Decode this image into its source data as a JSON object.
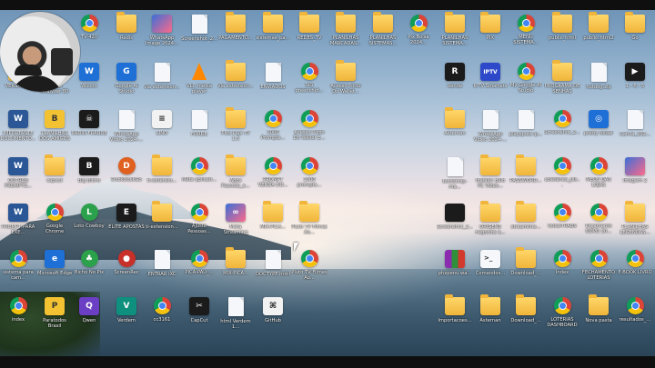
{
  "desktop": {
    "icons": [
      {
        "label": "TV-420",
        "glyph": "g-chrome",
        "text": ""
      },
      {
        "label": "Redis",
        "glyph": "g-folder",
        "text": ""
      },
      {
        "label": "WhatsApp Image 2024...",
        "glyph": "g-img",
        "text": ""
      },
      {
        "label": "Screenshot_2...",
        "glyph": "g-file",
        "text": ""
      },
      {
        "label": "PAGAMENTO...",
        "glyph": "g-folder",
        "text": ""
      },
      {
        "label": "sistemas_pa...",
        "glyph": "g-folder",
        "text": ""
      },
      {
        "label": "REDES_TV",
        "glyph": "g-folder",
        "text": ""
      },
      {
        "label": "PLANILHAS MARCADAS...",
        "glyph": "g-folder",
        "text": ""
      },
      {
        "label": "PLANILHAS SISTEMAS...",
        "glyph": "g-folder",
        "text": ""
      },
      {
        "label": "Pix Bolsa 2024...",
        "glyph": "g-chrome",
        "text": ""
      },
      {
        "label": "PLANILHAS SISTEMA...",
        "glyph": "g-folder",
        "text": ""
      },
      {
        "label": "PIX",
        "glyph": "g-folder",
        "text": ""
      },
      {
        "label": "MENU SISTEMA...",
        "glyph": "g-chrome",
        "text": ""
      },
      {
        "label": "public_html",
        "glyph": "g-folder",
        "text": ""
      },
      {
        "label": "public_html2",
        "glyph": "g-folder",
        "text": ""
      },
      {
        "label": "Go",
        "glyph": "g-folder",
        "text": ""
      },
      {
        "label": "VERSÃO_...",
        "glyph": "g-folder",
        "text": ""
      },
      {
        "label": "Studio Analyzer 80",
        "glyph": "g-white",
        "text": "S"
      },
      {
        "label": "Wicom",
        "glyph": "g-blue",
        "text": "W"
      },
      {
        "label": "Google AI Studio",
        "glyph": "g-blue",
        "text": "G"
      },
      {
        "label": "Via extension...",
        "glyph": "g-file",
        "text": ""
      },
      {
        "label": "VLC media player",
        "glyph": "g-vlc",
        "text": ""
      },
      {
        "label": "Via extension...",
        "glyph": "g-folder",
        "text": ""
      },
      {
        "label": "ENVIADOS",
        "glyph": "g-file",
        "text": ""
      },
      {
        "label": "SIG preenchid...",
        "glyph": "g-chrome",
        "text": ""
      },
      {
        "label": "Acesso Porto Do Wallet...",
        "glyph": "g-folder",
        "text": ""
      },
      {
        "label": "Rende",
        "glyph": "g-dark",
        "text": "R"
      },
      {
        "label": "IPTV Smarters",
        "glyph": "g-iptv",
        "text": "IPTV"
      },
      {
        "label": "My Google AI Studio",
        "glyph": "g-chrome",
        "text": ""
      },
      {
        "label": "PROGRAMA DE SENHAS",
        "glyph": "g-folder",
        "text": ""
      },
      {
        "label": "hotdog.zip",
        "glyph": "g-file",
        "text": ""
      },
      {
        "label": "1 - 6 - 5",
        "glyph": "g-dark",
        "text": "▶"
      },
      {
        "label": "IMPORTANTE DOCUMENTO...",
        "glyph": "g-word",
        "text": "W"
      },
      {
        "label": "PLANILHAS DOS AMIGOS",
        "glyph": "g-yellow",
        "text": "B"
      },
      {
        "label": "RADIO FRAUDE",
        "glyph": "g-dark",
        "text": "☠"
      },
      {
        "label": "WhatsApp Video 2024-...",
        "glyph": "g-file",
        "text": ""
      },
      {
        "label": "LINO",
        "glyph": "g-white",
        "text": "≡"
      },
      {
        "label": "FORDE",
        "glyph": "g-file",
        "text": ""
      },
      {
        "label": "Plus Plus TV 1.5",
        "glyph": "g-folder",
        "text": ""
      },
      {
        "label": "1000 Prompts...",
        "glyph": "g-chrome",
        "text": ""
      },
      {
        "label": "Acesso Porto Do Wallet E...",
        "glyph": "g-chrome",
        "text": ""
      },
      {
        "label": "Asternan",
        "glyph": "g-folder",
        "text": ""
      },
      {
        "label": "WhatsApp Video 2024-...",
        "glyph": "g-file",
        "text": ""
      },
      {
        "label": "playspots lp...",
        "glyph": "g-file",
        "text": ""
      },
      {
        "label": "Screenshot_2...",
        "glyph": "g-chrome",
        "text": ""
      },
      {
        "label": "pretty folder",
        "glyph": "g-blue",
        "text": "◎"
      },
      {
        "label": "Canva_202...",
        "glyph": "g-file",
        "text": ""
      },
      {
        "label": "OUTROS PROMPTS...",
        "glyph": "g-word",
        "text": "W"
      },
      {
        "label": "capcut",
        "glyph": "g-folder",
        "text": ""
      },
      {
        "label": "Big Bicho",
        "glyph": "g-dark",
        "text": "B"
      },
      {
        "label": "DuckDuckGo",
        "glyph": "g-orange",
        "text": "D"
      },
      {
        "label": "ti-extensio...",
        "glyph": "g-folder",
        "text": ""
      },
      {
        "label": "Meta aplicati...",
        "glyph": "g-chrome",
        "text": ""
      },
      {
        "label": "Âpps Pessoas_a...",
        "glyph": "g-folder",
        "text": ""
      },
      {
        "label": "PROMPT VENDA DO...",
        "glyph": "g-chrome",
        "text": ""
      },
      {
        "label": "1000 prompts...",
        "glyph": "g-chrome",
        "text": ""
      },
      {
        "label": "bootstrap-ma...",
        "glyph": "g-file",
        "text": ""
      },
      {
        "label": "Instalar pelo PC Video...",
        "glyph": "g-folder",
        "text": ""
      },
      {
        "label": "PASSWORD...",
        "glyph": "g-folder",
        "text": ""
      },
      {
        "label": "coletânea_pls...",
        "glyph": "g-chrome",
        "text": ""
      },
      {
        "label": "MEUS DAS LOJAS",
        "glyph": "g-chrome",
        "text": ""
      },
      {
        "label": "Imagem 2",
        "glyph": "g-img",
        "text": ""
      },
      {
        "label": "PROMPT PARA EXE...",
        "glyph": "g-word",
        "text": "W"
      },
      {
        "label": "Google Chrome",
        "glyph": "g-chrome",
        "text": ""
      },
      {
        "label": "Loto Cowboy",
        "glyph": "g-green",
        "text": "L"
      },
      {
        "label": "ELITE APOSTAS",
        "glyph": "g-dark",
        "text": "E"
      },
      {
        "label": "ti-extension...",
        "glyph": "g-folder",
        "text": ""
      },
      {
        "label": "Ajuste Pessoas...",
        "glyph": "g-chrome",
        "text": ""
      },
      {
        "label": "Meta Streaming",
        "glyph": "g-img",
        "text": "∞"
      },
      {
        "label": "MIX-PICA...",
        "glyph": "g-folder",
        "text": ""
      },
      {
        "label": "Pluto TV Filmes Ao...",
        "glyph": "g-folder",
        "text": ""
      },
      {
        "label": "Screenshot_2...",
        "glyph": "g-dark",
        "text": ""
      },
      {
        "label": "ORIGENS negocios a...",
        "glyph": "g-folder",
        "text": ""
      },
      {
        "label": "streamline...",
        "glyph": "g-folder",
        "text": ""
      },
      {
        "label": "todosTRABS",
        "glyph": "g-chrome",
        "text": ""
      },
      {
        "label": "Orçamento NOVO 20...",
        "glyph": "g-chrome",
        "text": ""
      },
      {
        "label": "PLANILHAS LEGENDAS...",
        "glyph": "g-folder",
        "text": ""
      },
      {
        "label": "sistema para cam...",
        "glyph": "g-chrome",
        "text": ""
      },
      {
        "label": "Microsoft Edge",
        "glyph": "g-blue",
        "text": "e"
      },
      {
        "label": "Bicho No Pix",
        "glyph": "g-green",
        "text": "♣"
      },
      {
        "label": "ScreenRec",
        "glyph": "g-red",
        "text": "●"
      },
      {
        "label": "ENTRAR IXC",
        "glyph": "g-file",
        "text": ""
      },
      {
        "label": "PICA-PAU_...",
        "glyph": "g-chrome",
        "text": ""
      },
      {
        "label": "MIX-PICA...",
        "glyph": "g-folder",
        "text": ""
      },
      {
        "label": "DOCTYPE html",
        "glyph": "g-file",
        "text": ""
      },
      {
        "label": "Pluto TV Filmes Ao...",
        "glyph": "g-chrome",
        "text": ""
      },
      {
        "label": "phxpenu wa...",
        "glyph": "g-winrar",
        "text": ""
      },
      {
        "label": "Comandos...",
        "glyph": "g-cmd",
        "text": ""
      },
      {
        "label": "Download_...",
        "glyph": "g-folder",
        "text": ""
      },
      {
        "label": "Index",
        "glyph": "g-chrome",
        "text": ""
      },
      {
        "label": "FECHAMENTO LOTERIAS",
        "glyph": "g-chrome",
        "text": ""
      },
      {
        "label": "E-BOOK LIVRO",
        "glyph": "g-chrome",
        "text": ""
      },
      {
        "label": "index",
        "glyph": "g-chrome",
        "text": ""
      },
      {
        "label": "Paratodos Brasil",
        "glyph": "g-yellow",
        "text": "P"
      },
      {
        "label": "Qwen",
        "glyph": "g-purple",
        "text": "Q"
      },
      {
        "label": "Verdem",
        "glyph": "g-teal",
        "text": "V"
      },
      {
        "label": "cc3161",
        "glyph": "g-chrome",
        "text": ""
      },
      {
        "label": "CapCut",
        "glyph": "g-dark",
        "text": "✂"
      },
      {
        "label": "html Verdem 1...",
        "glyph": "g-file",
        "text": ""
      },
      {
        "label": "GitHub",
        "glyph": "g-white",
        "text": "⌘"
      },
      {
        "label": "Importacoes...",
        "glyph": "g-folder",
        "text": ""
      },
      {
        "label": "Asternan",
        "glyph": "g-folder",
        "text": ""
      },
      {
        "label": "Download_...",
        "glyph": "g-folder",
        "text": ""
      },
      {
        "label": "LOTERIAS DASHBOARD",
        "glyph": "g-chrome",
        "text": ""
      },
      {
        "label": "Nova pasta",
        "glyph": "g-folder",
        "text": ""
      },
      {
        "label": "resultados_...",
        "glyph": "g-chrome",
        "text": ""
      },
      {
        "label": "MINHAS LISTAS",
        "glyph": "g-folder",
        "text": ""
      }
    ]
  }
}
